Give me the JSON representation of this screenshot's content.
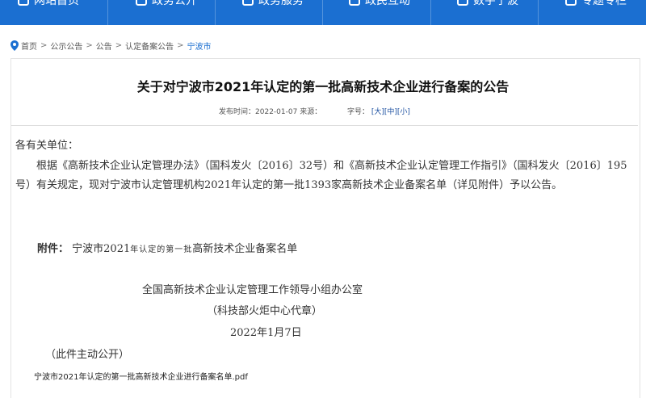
{
  "nav": {
    "items": [
      {
        "label": "网站首页",
        "icon": "home-icon"
      },
      {
        "label": "政务公开",
        "icon": "document-icon"
      },
      {
        "label": "政务服务",
        "icon": "service-icon"
      },
      {
        "label": "政民互动",
        "icon": "interaction-icon"
      },
      {
        "label": "数字宁波",
        "icon": "digital-icon"
      },
      {
        "label": "专题专栏",
        "icon": "topic-icon"
      }
    ],
    "bg_color": "#1b6fd1"
  },
  "breadcrumb": {
    "items": [
      "首页",
      "公示公告",
      "公告",
      "认定备案公告"
    ],
    "current": "宁波市",
    "sep": ">"
  },
  "article": {
    "title": "关于对宁波市2021年认定的第一批高新技术企业进行备案的公告",
    "meta": {
      "date_label": "发布时间：",
      "date": "2022-01-07",
      "source_label": "来源：",
      "fontsize_label": "字号：",
      "size_large": "[大]",
      "size_medium": "[中]",
      "size_small": "[小]"
    },
    "salutation": "各有关单位：",
    "paragraph": "根据《高新技术企业认定管理办法》（国科发火〔2016〕32号）和《高新技术企业认定管理工作指引》（国科发火〔2016〕195号）有关规定，现对宁波市认定管理机构2021年认定的第一批1393家高新技术企业备案名单（详见附件）予以公告。",
    "attachment_label": "附件：",
    "attachment_part1": "宁波市2021",
    "attachment_part2": "年认定的第一批",
    "attachment_part3": "高新技术企业备案名单",
    "signature_org": "全国高新技术企业认定管理工作领导小组办公室",
    "signature_proxy": "（科技部火炬中心代章）",
    "signature_date": "2022年1月7日",
    "note": "（此件主动公开）",
    "pdf_link": "宁波市2021年认定的第一批高新技术企业进行备案名单.pdf"
  }
}
